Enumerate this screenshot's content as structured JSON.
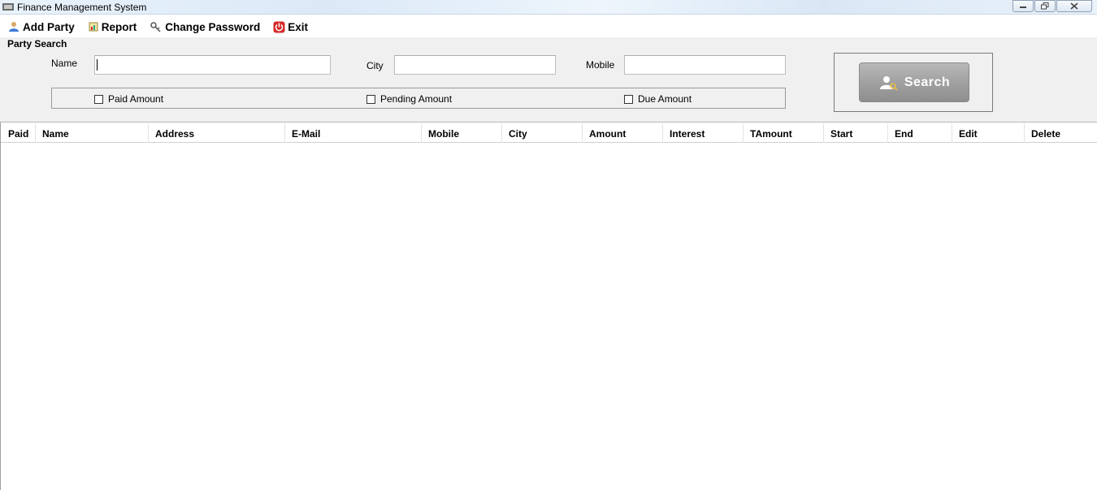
{
  "window": {
    "title": "Finance Management System"
  },
  "menu": {
    "add_party": "Add Party",
    "report": "Report",
    "change_password": "Change Password",
    "exit": "Exit"
  },
  "search": {
    "group_title": "Party Search",
    "name_label": "Name",
    "name_value": "",
    "city_label": "City",
    "city_value": "",
    "mobile_label": "Mobile",
    "mobile_value": "",
    "checks": {
      "paid": "Paid Amount",
      "pending": "Pending Amount",
      "due": "Due Amount"
    },
    "button_label": "Search"
  },
  "grid": {
    "columns": [
      "Paid",
      "Name",
      "Address",
      "E-Mail",
      "Mobile",
      "City",
      "Amount",
      "Interest",
      "TAmount",
      "Start",
      "End",
      "Edit",
      "Delete"
    ],
    "rows": []
  },
  "colors": {
    "accent_exit": "#d62b2b",
    "search_button": "#a3a3a3"
  }
}
